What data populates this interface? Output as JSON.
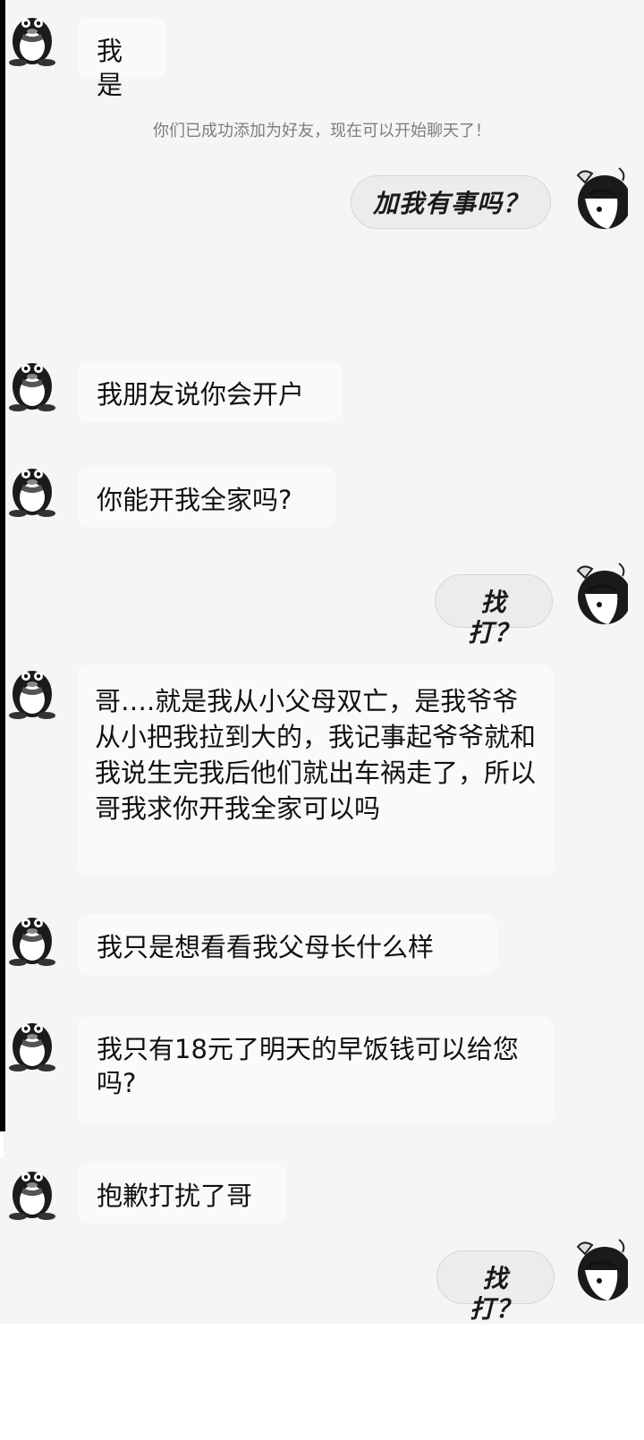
{
  "system_notice": "你们已成功添加为好友，现在可以开始聊天了！",
  "messages": [
    {
      "side": "left",
      "text": "我是"
    },
    {
      "side": "right",
      "text": "加我有事吗？"
    },
    {
      "side": "left",
      "text": "我朋友说你会开户"
    },
    {
      "side": "left",
      "text": "你能开我全家吗?"
    },
    {
      "side": "right",
      "text": "找打？"
    },
    {
      "side": "left",
      "text": "哥….就是我从小父母双亡，是我爷爷从小把我拉到大的，我记事起爷爷就和我说生完我后他们就出车祸走了，所以哥我求你开我全家可以吗"
    },
    {
      "side": "left",
      "text": "我只是想看看我父母长什么样"
    },
    {
      "side": "left",
      "text": "我只有18元了明天的早饭钱可以给您吗?"
    },
    {
      "side": "left",
      "text": "抱歉打扰了哥"
    },
    {
      "side": "right",
      "text": "找打？"
    }
  ],
  "icons": {
    "left_avatar": "qq-penguin-avatar-icon",
    "right_avatar": "anime-boy-avatar-icon"
  }
}
